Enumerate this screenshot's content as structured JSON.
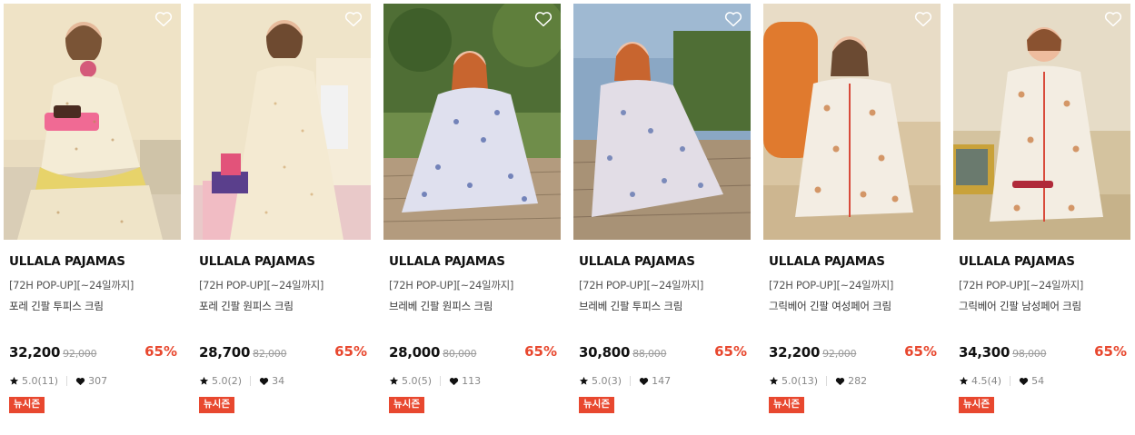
{
  "products": [
    {
      "brand": "ULLALA PAJAMAS",
      "tag": "[72H POP-UP][~24일까지]",
      "name": "포레 긴팔 투피스 크림",
      "price": "32,200",
      "original_price": "92,000",
      "discount": "65%",
      "rating": "5.0(11)",
      "likes": "307",
      "badge": "뉴시즌"
    },
    {
      "brand": "ULLALA PAJAMAS",
      "tag": "[72H POP-UP][~24일까지]",
      "name": "포레 긴팔 원피스 크림",
      "price": "28,700",
      "original_price": "82,000",
      "discount": "65%",
      "rating": "5.0(2)",
      "likes": "34",
      "badge": "뉴시즌"
    },
    {
      "brand": "ULLALA PAJAMAS",
      "tag": "[72H POP-UP][~24일까지]",
      "name": "브레베 긴팔 원피스 크림",
      "price": "28,000",
      "original_price": "80,000",
      "discount": "65%",
      "rating": "5.0(5)",
      "likes": "113",
      "badge": "뉴시즌"
    },
    {
      "brand": "ULLALA PAJAMAS",
      "tag": "[72H POP-UP][~24일까지]",
      "name": "브레베 긴팔 투피스 크림",
      "price": "30,800",
      "original_price": "88,000",
      "discount": "65%",
      "rating": "5.0(3)",
      "likes": "147",
      "badge": "뉴시즌"
    },
    {
      "brand": "ULLALA PAJAMAS",
      "tag": "[72H POP-UP][~24일까지]",
      "name": "그릭베어 긴팔 여성페어 크림",
      "price": "32,200",
      "original_price": "92,000",
      "discount": "65%",
      "rating": "5.0(13)",
      "likes": "282",
      "badge": "뉴시즌"
    },
    {
      "brand": "ULLALA PAJAMAS",
      "tag": "[72H POP-UP][~24일까지]",
      "name": "그릭베어 긴팔 남성페어 크림",
      "price": "34,300",
      "original_price": "98,000",
      "discount": "65%",
      "rating": "4.5(4)",
      "likes": "54",
      "badge": "뉴시즌"
    }
  ],
  "colors": {
    "accent": "#e8482f",
    "text": "#111111",
    "muted": "#999999"
  },
  "icons": {
    "wishlist": "heart-outline-icon",
    "rating": "star-icon",
    "likes": "heart-filled-icon"
  }
}
